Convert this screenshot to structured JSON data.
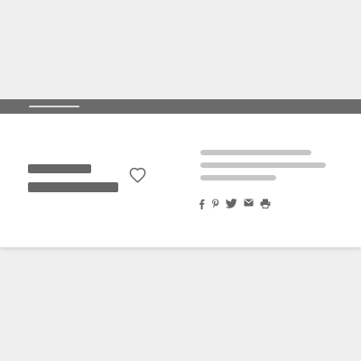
{
  "colors": {
    "background": "#efefef",
    "card": "#ffffff",
    "header_bar": "#6b6b6b",
    "header_tab_line": "#d9d9d9",
    "title_placeholder": "#666666",
    "text_placeholder": "#c6c6c6",
    "icon": "#666666"
  },
  "header": {
    "active_tab_icon": "tab-indicator"
  },
  "product": {
    "favorite_icon": "heart-outline-icon"
  },
  "share": {
    "icons": [
      "facebook-icon",
      "pinterest-icon",
      "twitter-icon",
      "email-icon",
      "print-icon"
    ]
  }
}
